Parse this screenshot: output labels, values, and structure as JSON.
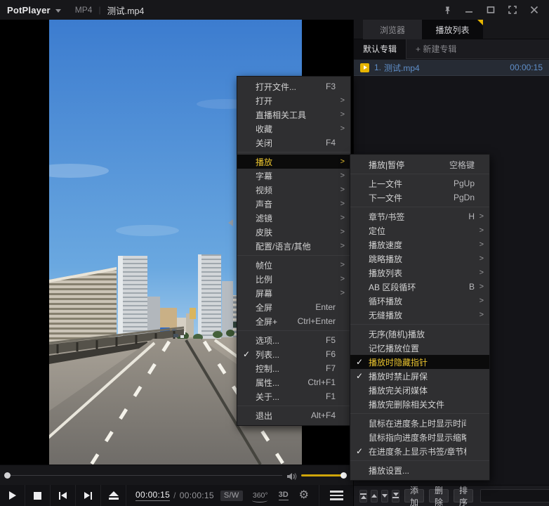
{
  "title_bar": {
    "app_name": "PotPlayer",
    "codec_badge": "MP4",
    "divider": "|",
    "file_name": "测试.mp4"
  },
  "playlist_panel": {
    "tabs": [
      {
        "label": "浏览器",
        "active": false
      },
      {
        "label": "播放列表",
        "active": true
      }
    ],
    "album_tabs": [
      {
        "label": "默认专辑",
        "active": true
      },
      {
        "label": "+ 新建专辑",
        "active": false
      }
    ],
    "items": [
      {
        "position": "1.",
        "name": "测试.mp4",
        "duration": "00:00:15",
        "selected": true
      }
    ],
    "toolbar": {
      "buttons": [
        {
          "label": "添加"
        },
        {
          "label": "删除"
        },
        {
          "label": "排序"
        }
      ],
      "search_placeholder": ""
    }
  },
  "context_menu": {
    "items": [
      {
        "label": "打开文件...",
        "shortcut": "F3"
      },
      {
        "label": "打开",
        "submenu": true
      },
      {
        "label": "直播相关工具",
        "submenu": true
      },
      {
        "label": "收藏",
        "submenu": true
      },
      {
        "label": "关闭",
        "shortcut": "F4"
      },
      {
        "label": "播放",
        "submenu": true,
        "highlighted": true
      },
      {
        "label": "字幕",
        "submenu": true
      },
      {
        "label": "视频",
        "submenu": true
      },
      {
        "label": "声音",
        "submenu": true
      },
      {
        "label": "滤镜",
        "submenu": true
      },
      {
        "label": "皮肤",
        "submenu": true
      },
      {
        "label": "配置/语言/其他",
        "submenu": true
      },
      {
        "label": "帧位",
        "submenu": true
      },
      {
        "label": "比例",
        "submenu": true
      },
      {
        "label": "屏幕",
        "submenu": true
      },
      {
        "label": "全屏",
        "shortcut": "Enter"
      },
      {
        "label": "全屏+",
        "shortcut": "Ctrl+Enter"
      },
      {
        "label": "选项...",
        "shortcut": "F5"
      },
      {
        "label": "列表...",
        "shortcut": "F6",
        "checked": true
      },
      {
        "label": "控制...",
        "shortcut": "F7"
      },
      {
        "label": "属性...",
        "shortcut": "Ctrl+F1"
      },
      {
        "label": "关于...",
        "shortcut": "F1"
      },
      {
        "label": "退出",
        "shortcut": "Alt+F4"
      }
    ]
  },
  "play_submenu": {
    "items": [
      {
        "label": "播放|暂停",
        "shortcut": "空格键"
      },
      {
        "label": "上一文件",
        "shortcut": "PgUp"
      },
      {
        "label": "下一文件",
        "shortcut": "PgDn"
      },
      {
        "label": "章节/书签",
        "shortcut": "H",
        "submenu": true
      },
      {
        "label": "定位",
        "submenu": true
      },
      {
        "label": "播放速度",
        "submenu": true
      },
      {
        "label": "跳略播放",
        "submenu": true
      },
      {
        "label": "播放列表",
        "submenu": true
      },
      {
        "label": "AB 区段循环",
        "shortcut": "B",
        "submenu": true
      },
      {
        "label": "循环播放",
        "submenu": true
      },
      {
        "label": "无缝播放",
        "submenu": true
      },
      {
        "label": "无序(随机)播放"
      },
      {
        "label": "记忆播放位置"
      },
      {
        "label": "播放时隐藏指针",
        "checked": true,
        "highlighted": true
      },
      {
        "label": "播放时禁止屏保",
        "checked": true
      },
      {
        "label": "播放完关闭媒体"
      },
      {
        "label": "播放完删除相关文件"
      },
      {
        "label": "鼠标在进度条上时显示时间"
      },
      {
        "label": "鼠标指向进度条时显示缩略图"
      },
      {
        "label": "在进度条上显示书签/章节标记",
        "checked": true
      },
      {
        "label": "播放设置..."
      }
    ]
  },
  "transport": {
    "time_current": "00:00:15",
    "time_separator": "/",
    "time_total": "00:00:15",
    "decoder_badge": "S/W",
    "rotation_label": "360°",
    "stereo_label": "3D"
  },
  "seek_bar": {
    "position_fraction": 0,
    "volume_fraction": 1
  },
  "colors": {
    "accent_yellow": "#e6b400",
    "menu_highlight_bg": "#0b0b0b",
    "menu_highlight_text": "#e8c22e",
    "playlist_blue": "#5f8ec8",
    "volume_yellow": "#cfa50a"
  }
}
